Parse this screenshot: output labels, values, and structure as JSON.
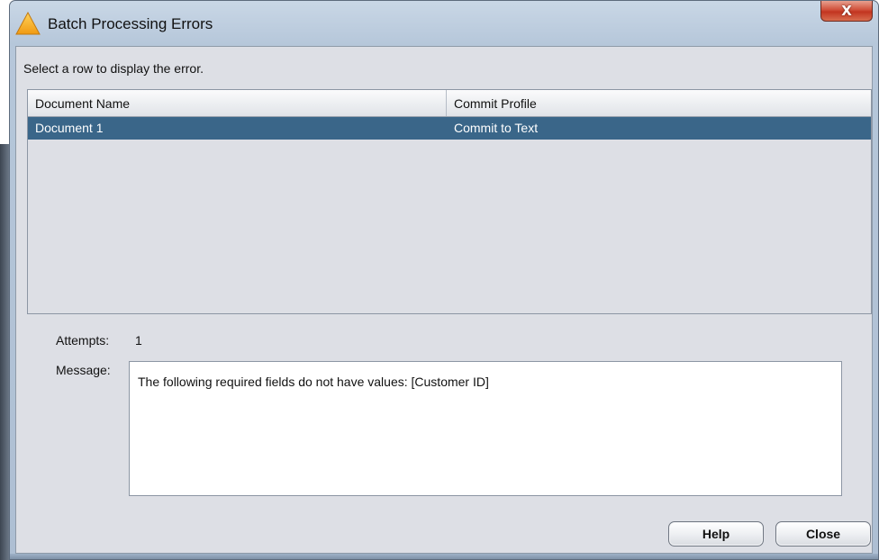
{
  "window": {
    "title": "Batch Processing Errors",
    "title_icon": "warning-triangle-icon",
    "close_glyph": "X",
    "accent_close": "#c23420"
  },
  "instruction": "Select a row to display the error.",
  "table": {
    "columns": [
      "Document Name",
      "Commit Profile"
    ],
    "rows": [
      {
        "document_name": "Document 1",
        "commit_profile": "Commit to Text",
        "selected": true
      }
    ],
    "selected_row_color": "#3a6689"
  },
  "details": {
    "attempts_label": "Attempts:",
    "attempts_value": "1",
    "message_label": "Message:",
    "message_text": "The following required fields do not have values: [Customer ID]"
  },
  "buttons": {
    "help": "Help",
    "close": "Close"
  }
}
